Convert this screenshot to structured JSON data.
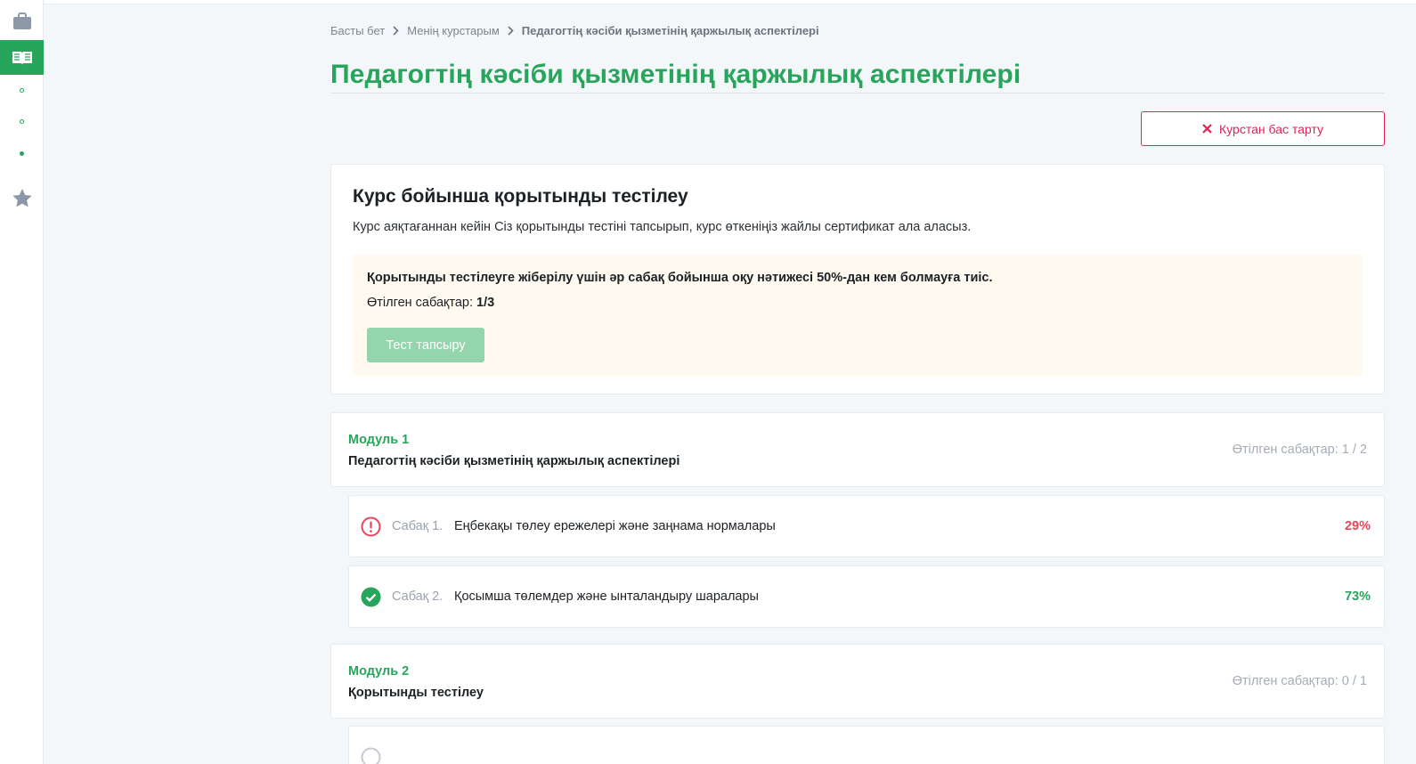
{
  "colors": {
    "accent": "#27a55a",
    "danger": "#e02256",
    "fail": "#e8445a",
    "muted": "#a4adb6"
  },
  "sidebar": {
    "items": [
      {
        "icon": "briefcase-icon",
        "active": false
      },
      {
        "icon": "book-icon",
        "active": true
      },
      {
        "icon": "submenu-dot-icon",
        "active": false
      },
      {
        "icon": "submenu-dot-icon",
        "active": false
      },
      {
        "icon": "submenu-dot-filled-icon",
        "active": false
      },
      {
        "icon": "star-icon",
        "active": false
      }
    ]
  },
  "breadcrumb": {
    "home": "Басты бет",
    "my_courses": "Менің курстарым",
    "current": "Педагогтің кәсіби қызметінің қаржылық аспектілері"
  },
  "page": {
    "title": "Педагогтің кәсіби қызметінің қаржылық аспектілері",
    "cancel_label": "Курстан бас тарту"
  },
  "final_test": {
    "title": "Курс бойынша қорытынды тестілеу",
    "description": "Курс аяқтағаннан кейін Сіз қорытынды тестіні тапсырып, курс өткеніңіз жайлы сертификат ала аласыз.",
    "requirement": "Қорытынды тестілеуге жіберілу үшін әр сабақ бойынша оқу нәтижесі 50%-дан кем болмауға тиіс.",
    "passed_label": "Өтілген сабақтар:",
    "passed_value": "1/3",
    "button_label": "Тест тапсыру"
  },
  "modules": [
    {
      "label": "Модуль 1",
      "name": "Педагогтің кәсіби қызметінің қаржылық аспектілері",
      "progress": "Өтілген сабақтар: 1 / 2",
      "lessons": [
        {
          "num": "Сабақ 1.",
          "title": "Еңбекақы төлеу ережелері және заңнама нормалары",
          "percent": "29%",
          "status": "failed"
        },
        {
          "num": "Сабақ 2.",
          "title": "Қосымша төлемдер және ынталандыру шаралары",
          "percent": "73%",
          "status": "passed"
        }
      ]
    },
    {
      "label": "Модуль 2",
      "name": "Қорытынды тестілеу",
      "progress": "Өтілген сабақтар: 0 / 1",
      "lessons": []
    }
  ]
}
